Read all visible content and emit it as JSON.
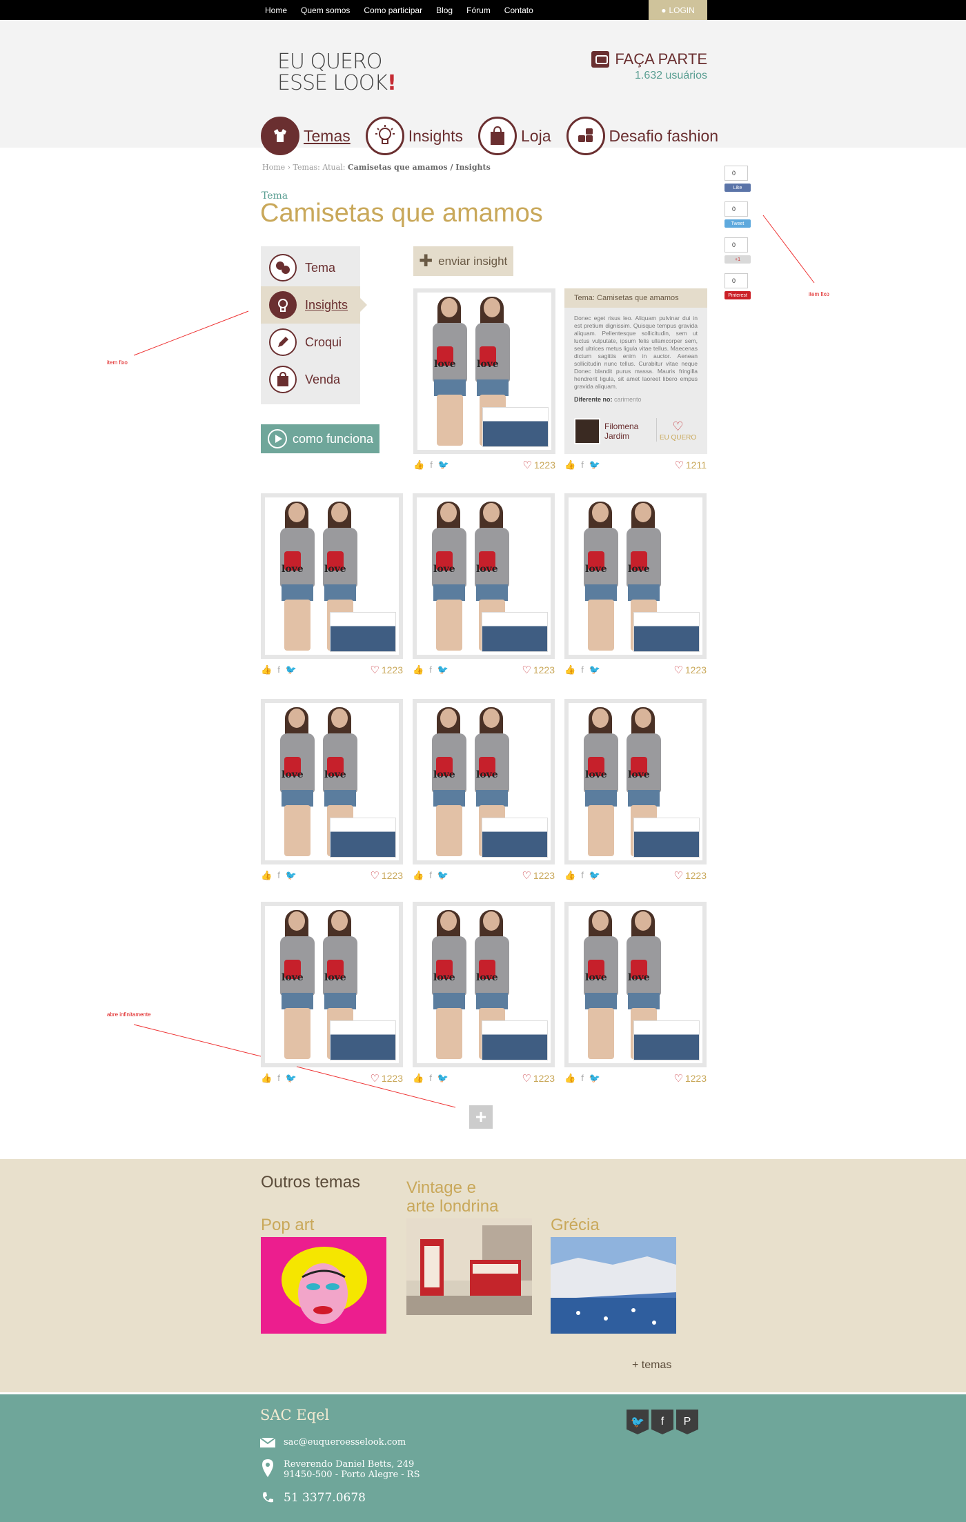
{
  "topnav": {
    "items": [
      "Home",
      "Quem somos",
      "Como participar",
      "Blog",
      "Fórum",
      "Contato"
    ],
    "login": "LOGIN"
  },
  "header": {
    "logo_line1": "EU QUERO",
    "logo_line2": "ESSE LOOK",
    "logo_mark": "!",
    "faca_parte": "FAÇA PARTE",
    "users": "1.632 usuários"
  },
  "mainnav": {
    "items": [
      "Temas",
      "Insights",
      "Loja",
      "Desafio fashion"
    ]
  },
  "breadcrumb": {
    "prefix": "Home › Temas: Atual:",
    "current": "Camisetas que amamos / Insights"
  },
  "page": {
    "kicker": "Tema",
    "title": "Camisetas que amamos"
  },
  "sidemenu": {
    "items": [
      "Tema",
      "Insights",
      "Croqui",
      "Venda"
    ]
  },
  "como_funciona": "como funciona",
  "enviar_insight": "enviar insight",
  "cards": {
    "likes": "1223",
    "shirt_text": "love"
  },
  "infocard": {
    "title": "Tema: Camisetas que amamos",
    "body": "Donec eget risus leo. Aliquam pulvinar dui in est pretium dignissim. Quisque tempus gravida aliquam. Pellentesque sollicitudin, sem ut luctus vulputate, ipsum felis ullamcorper sem, sed ultrices metus ligula vitae tellus. Maecenas dictum sagittis enim in auctor. Aenean sollicitudin nunc tellus. Curabitur vitae neque Donec blandit purus massa. Mauris fringilla hendrerit ligula, sit amet laoreet libero empus gravida aliquam.",
    "diferente_label": "Diferente no:",
    "diferente_value": "carimento",
    "author_first": "Filomena",
    "author_last": "Jardim",
    "euquero": "EU QUERO",
    "likes": "1211"
  },
  "social": {
    "counts": [
      "0",
      "0",
      "0",
      "0"
    ],
    "buttons": [
      "Like",
      "Tweet",
      "+1",
      "Pinterest"
    ]
  },
  "annotations": {
    "fixed_right": "item fixo",
    "fixed_left": "item fixo",
    "infinite": "abre infinitamente"
  },
  "outros": {
    "title": "Outros temas",
    "temas": [
      {
        "line1": "",
        "line2": "Pop art"
      },
      {
        "line1": "Vintage e",
        "line2": "arte londrina"
      },
      {
        "line1": "",
        "line2": "Grécia"
      }
    ],
    "mais": "+ temas"
  },
  "footer": {
    "title": "SAC Eqel",
    "email": "sac@euqueroesselook.com",
    "address1": "Reverendo Daniel Betts, 249",
    "address2": "91450-500 - Porto Alegre - RS",
    "phone": "51 3377.0678"
  },
  "colors": {
    "brand": "#6a2f30",
    "gold": "#c9a85a",
    "teal": "#6fa69a",
    "beige": "#e8e0cc"
  }
}
